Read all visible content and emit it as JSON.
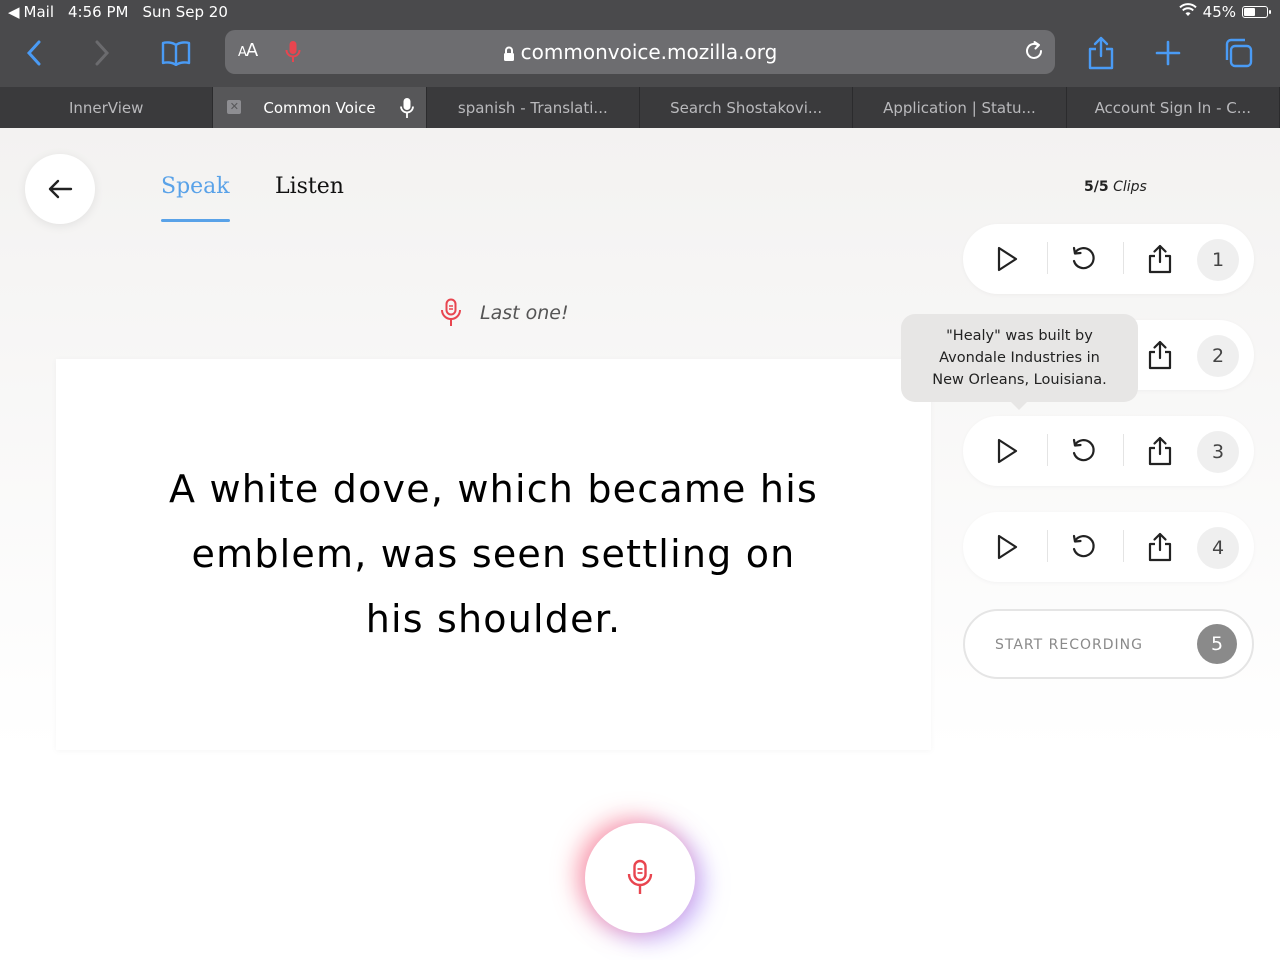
{
  "status": {
    "back_app": "Mail",
    "time": "4:56 PM",
    "date": "Sun Sep 20",
    "battery": "45%",
    "battery_level": 0.45
  },
  "browser": {
    "aa_label_small": "A",
    "aa_label_big": "A",
    "url": "commonvoice.mozilla.org",
    "tabs": [
      {
        "label": "InnerView"
      },
      {
        "label": "Common Voice"
      },
      {
        "label": "spanish - Translati..."
      },
      {
        "label": "Search Shostakovi..."
      },
      {
        "label": "Application | Statu..."
      },
      {
        "label": "Account Sign In - C..."
      }
    ]
  },
  "nav": {
    "speak": "Speak",
    "listen": "Listen"
  },
  "clips": {
    "count": "5/5",
    "word": "Clips"
  },
  "prompt": {
    "last_one": "Last one!"
  },
  "sentence": "A white dove, which became his emblem, was seen settling on his shoulder.",
  "clip_list": [
    {
      "number": "1"
    },
    {
      "number": "2"
    },
    {
      "number": "3"
    },
    {
      "number": "4"
    }
  ],
  "record": {
    "label": "START RECORDING",
    "number": "5"
  },
  "tooltip": {
    "line1": "\"Healy\" was built by",
    "line2": "Avondale Industries in",
    "line3": "New Orleans, Louisiana."
  },
  "colors": {
    "accent_blue": "#59a2e8",
    "mic_red": "#e8454f",
    "safari_blue": "#4a9bf5"
  }
}
